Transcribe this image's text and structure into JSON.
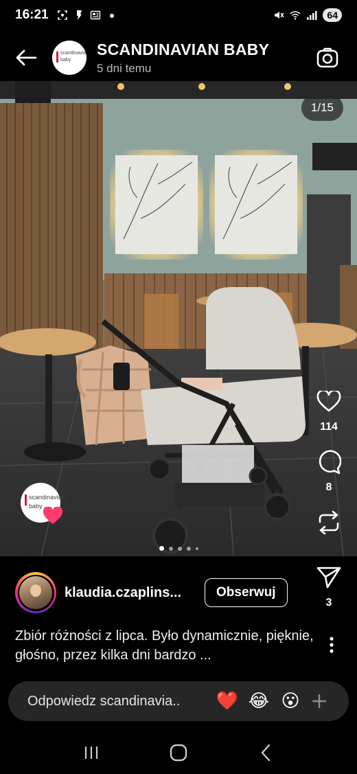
{
  "status": {
    "time": "16:21",
    "battery": "64",
    "icons": [
      "screenshot-icon",
      "flashlight-icon",
      "news-icon",
      "dot-icon",
      "mute-icon",
      "wifi-icon",
      "signal-icon"
    ]
  },
  "header": {
    "account_name": "SCANDINAVIAN BABY",
    "posted": "5 dni temu",
    "logo_line1": "scandinavian",
    "logo_line2": "baby"
  },
  "media": {
    "counter": "1/15",
    "overlay_logo_line1": "scandinavian",
    "overlay_logo_line2": "baby",
    "carousel_current_index": 0
  },
  "actions": {
    "likes": "114",
    "comments": "8",
    "shares": "3"
  },
  "author": {
    "username": "klaudia.czaplins...",
    "follow_label": "Obserwuj"
  },
  "caption": {
    "text": "Zbiór różności z lipca. Było dynamicznie, pięknie, głośno, przez kilka dni bardzo ..."
  },
  "reply": {
    "placeholder": "Odpowiedz scandinavia..",
    "emojis": [
      "❤️",
      "😂",
      "😮"
    ]
  },
  "colors": {
    "background": "#000000",
    "reply_bar": "#262626",
    "story_ring": [
      "#f9ce34",
      "#ee2a7b",
      "#6228d7"
    ],
    "heart_badge": "#ff3b6b"
  }
}
